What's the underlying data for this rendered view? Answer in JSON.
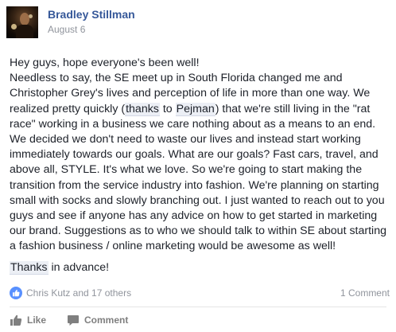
{
  "post": {
    "author": "Bradley Stillman",
    "date": "August 6",
    "paragraphs": {
      "p1_text_a": "Hey guys, hope everyone's been well!\nNeedless to say, the SE meet up in South Florida changed me and Christopher Grey's lives and perception of life in more than one way. We realized pretty quickly (",
      "tag_thanks": "thanks",
      "p1_text_b": " to ",
      "tag_pejman": "Pejman",
      "p1_text_c": ") that we're still living in the \"rat race\" working in a business we care nothing about as a means to an end. We decided we don't need to waste our lives and instead start working immediately towards our goals. What are our goals? Fast cars, travel, and above all, STYLE. It's what we love. So we're going to start making the transition from the service industry into fashion. We're planning on starting small with socks and slowly branching out. I just wanted to reach out to you guys and see if anyone has any advice on how to get started in marketing our brand. Suggestions as to who we should talk to within SE about starting a fashion business / online marketing would be awesome as well!",
      "tag_thanks2": "Thanks",
      "p2_text": " in advance!"
    }
  },
  "stats": {
    "likers": "Chris Kutz and 17 others",
    "comments": "1 Comment"
  },
  "actions": {
    "like": "Like",
    "comment": "Comment"
  },
  "colors": {
    "author_link": "#365899",
    "like_badge": "#5890ff",
    "muted_text": "#90949c"
  }
}
